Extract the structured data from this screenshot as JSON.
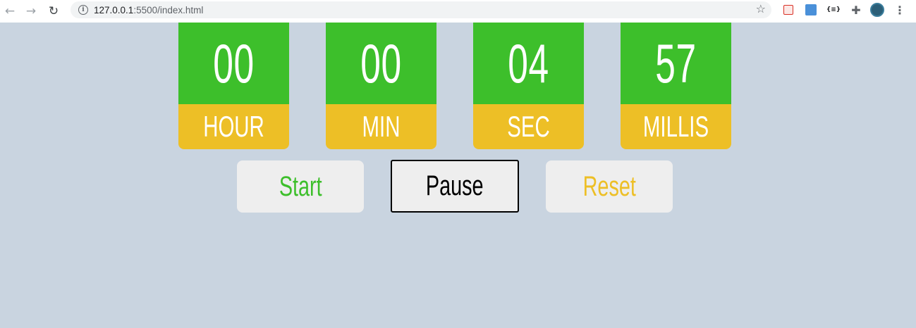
{
  "browser": {
    "url_host": "127.0.0.1",
    "url_rest": ":5500/index.html"
  },
  "stopwatch": {
    "hour": {
      "value": "00",
      "label": "HOUR"
    },
    "min": {
      "value": "00",
      "label": "MIN"
    },
    "sec": {
      "value": "04",
      "label": "SEC"
    },
    "millis": {
      "value": "57",
      "label": "MILLIS"
    }
  },
  "controls": {
    "start_label": "Start",
    "pause_label": "Pause",
    "reset_label": "Reset"
  },
  "colors": {
    "background": "#c9d4e0",
    "digit_panel": "#3dbf2b",
    "label_panel": "#edbf26",
    "button": "#eeeeee"
  },
  "icons": [
    "back-arrow-icon",
    "forward-arrow-icon",
    "reload-icon",
    "info-icon",
    "star-icon",
    "extension-icon",
    "profile-icon",
    "menu-icon"
  ]
}
